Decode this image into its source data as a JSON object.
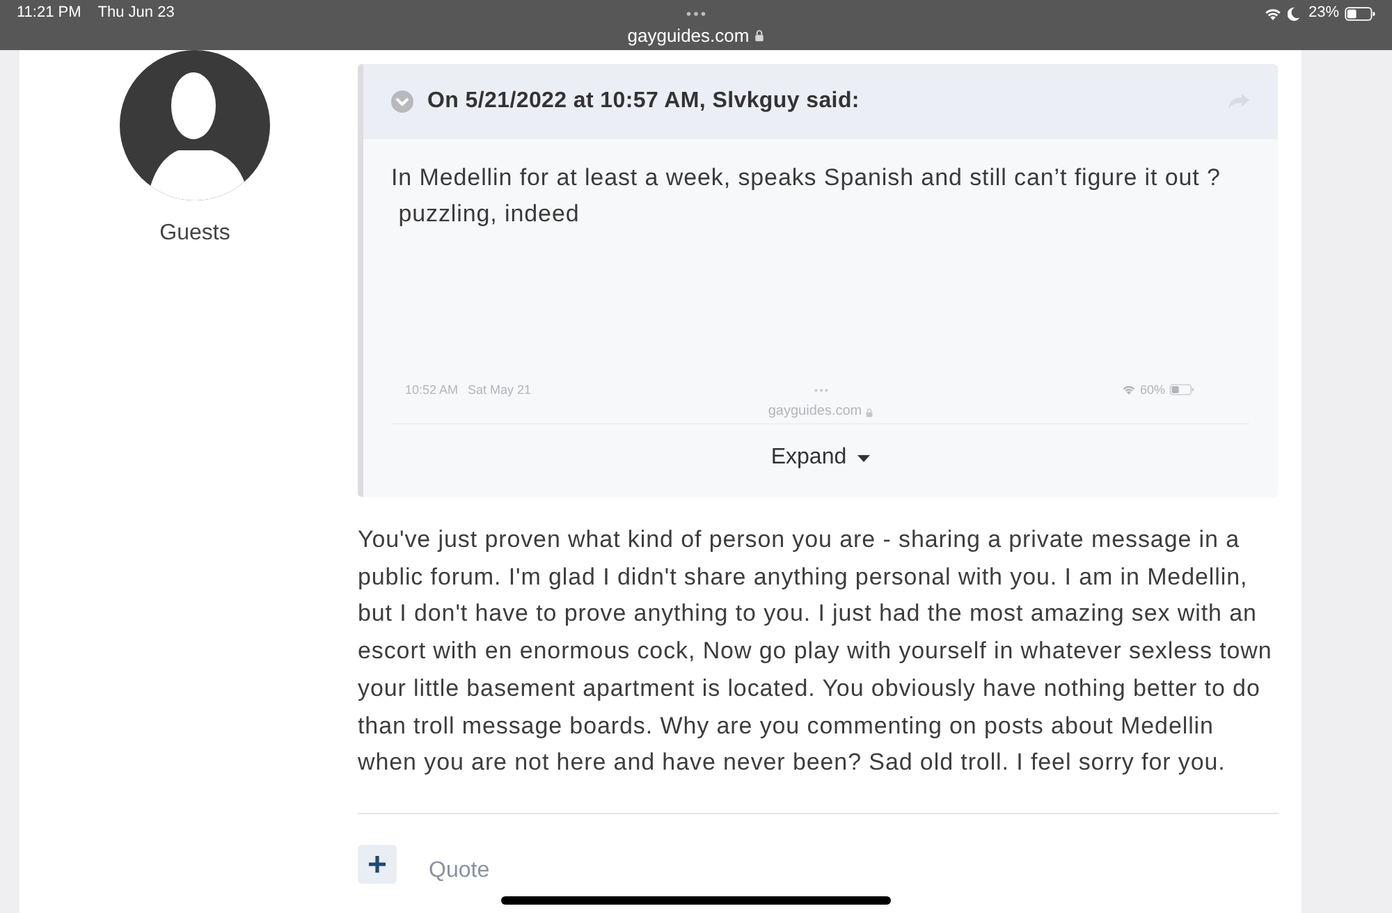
{
  "status_bar": {
    "time": "11:21 PM",
    "date": "Thu Jun 23",
    "url": "gayguides.com",
    "battery": "23%"
  },
  "author": {
    "group": "Guests"
  },
  "quote": {
    "header": "On 5/21/2022 at 10:57 AM, Slvkguy said:",
    "lines": [
      "In Medellin for at least a week, speaks Spanish and still can’t figure it out ?",
      " puzzling, indeed"
    ],
    "embedded_screenshot": {
      "time": "10:52 AM",
      "date": "Sat May 21",
      "url": "gayguides.com",
      "battery": "60%"
    },
    "expand": "Expand"
  },
  "post_body": "You've just proven what kind of person you are - sharing a private message in a public forum. I'm glad I didn't share anything personal with you. I am in Medellin, but I don't have to prove anything to you. I just had the most amazing sex with an escort with en enormous cock, Now go play with yourself in whatever sexless town your little basement apartment is located. You obviously have nothing better to do than troll message boards. Why are you commenting on posts about Medellin when you are not here and have never been? Sad old troll. I feel sorry for you.",
  "actions": {
    "quote": "Quote"
  }
}
